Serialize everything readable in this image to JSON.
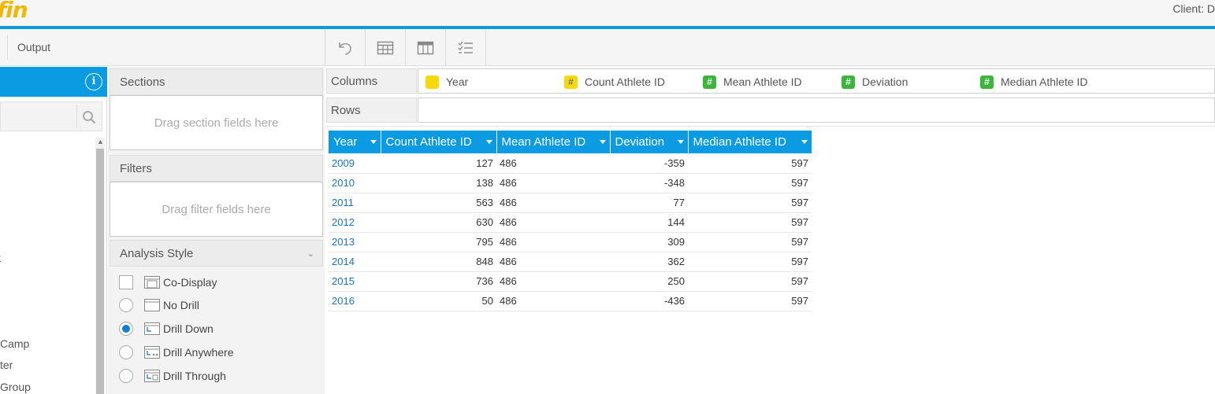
{
  "header": {
    "logo_text": "fin",
    "client_label": "Client: D"
  },
  "toolbar": {
    "output_label": "Output",
    "buttons": [
      "undo-icon",
      "table-columns-icon",
      "layout-icon",
      "list-checks-icon"
    ]
  },
  "left_panel": {
    "info_icon": "i",
    "items": [
      "t",
      "Camp",
      "ter",
      "Group"
    ]
  },
  "middle_panel": {
    "sections_title": "Sections",
    "sections_placeholder": "Drag section fields here",
    "filters_title": "Filters",
    "filters_placeholder": "Drag filter fields here",
    "analysis_style_title": "Analysis Style",
    "options": [
      {
        "label": "Co-Display",
        "type": "checkbox",
        "selected": false
      },
      {
        "label": "No Drill",
        "type": "radio",
        "selected": false
      },
      {
        "label": "Drill Down",
        "type": "radio",
        "selected": true
      },
      {
        "label": "Drill Anywhere",
        "type": "radio",
        "selected": false
      },
      {
        "label": "Drill Through",
        "type": "radio",
        "selected": false
      }
    ]
  },
  "builder": {
    "columns_label": "Columns",
    "rows_label": "Rows",
    "column_chips": [
      {
        "label": "Year",
        "icon": "",
        "color": "#f5d90a"
      },
      {
        "label": "Count Athlete ID",
        "icon": "#",
        "color": "#f5d90a"
      },
      {
        "label": "Mean Athlete ID",
        "icon": "#",
        "color": "#3cb53c"
      },
      {
        "label": "Deviation",
        "icon": "#",
        "color": "#3cb53c"
      },
      {
        "label": "Median Athlete ID",
        "icon": "#",
        "color": "#3cb53c"
      }
    ]
  },
  "table": {
    "headers": [
      "Year",
      "Count Athlete ID",
      "Mean Athlete ID",
      "Deviation",
      "Median Athlete ID"
    ],
    "rows": [
      [
        "2009",
        "127",
        "486",
        "-359",
        "597"
      ],
      [
        "2010",
        "138",
        "486",
        "-348",
        "597"
      ],
      [
        "2011",
        "563",
        "486",
        "77",
        "597"
      ],
      [
        "2012",
        "630",
        "486",
        "144",
        "597"
      ],
      [
        "2013",
        "795",
        "486",
        "309",
        "597"
      ],
      [
        "2014",
        "848",
        "486",
        "362",
        "597"
      ],
      [
        "2015",
        "736",
        "486",
        "250",
        "597"
      ],
      [
        "2016",
        "50",
        "486",
        "-436",
        "597"
      ]
    ]
  },
  "colors": {
    "accent": "#0b9be3",
    "logo": "#f2b800",
    "year_link": "#1a73c7"
  }
}
